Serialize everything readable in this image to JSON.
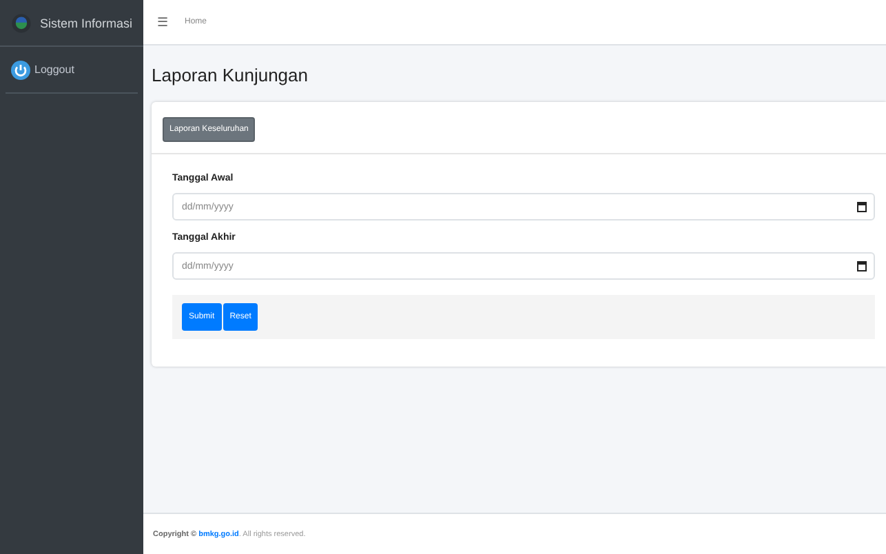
{
  "sidebar": {
    "brand": "Sistem Informasi",
    "items": [
      {
        "label": "Loggout"
      }
    ]
  },
  "navbar": {
    "menu_icon": "☰",
    "links": [
      "Home"
    ]
  },
  "page_title": "Laporan Kunjungan",
  "card": {
    "header_button": "Laporan Keseluruhan",
    "fields": [
      {
        "label": "Tanggal Awal",
        "placeholder": "dd/mm/yyyy"
      },
      {
        "label": "Tanggal Akhir",
        "placeholder": "dd/mm/yyyy"
      }
    ],
    "buttons": [
      "Submit",
      "Reset"
    ]
  },
  "footer": {
    "prefix": "Copyright ©",
    "link": "bmkg.go.id",
    "suffix": ". All rights reserved."
  }
}
